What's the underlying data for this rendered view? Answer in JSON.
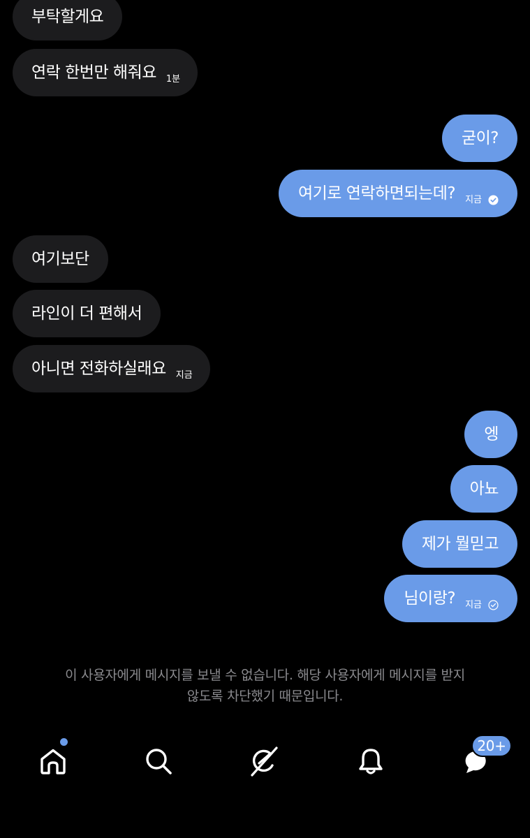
{
  "conversation": {
    "messages": [
      {
        "direction": "received",
        "text": "부탁할게요",
        "time": "",
        "read": false
      },
      {
        "direction": "received",
        "text": "연락 한번만 해줘요",
        "time": "1분",
        "read": false
      },
      {
        "direction": "sent",
        "text": "굳이?",
        "time": "",
        "read": false
      },
      {
        "direction": "sent",
        "text": "여기로 연락하면되는데?",
        "time": "지금",
        "read": true
      },
      {
        "direction": "received",
        "text": "여기보단",
        "time": "",
        "read": false
      },
      {
        "direction": "received",
        "text": "라인이 더 편해서",
        "time": "",
        "read": false
      },
      {
        "direction": "received",
        "text": "아니면 전화하실래요",
        "time": "지금",
        "read": false
      },
      {
        "direction": "sent",
        "text": "엥",
        "time": "",
        "read": false
      },
      {
        "direction": "sent",
        "text": "아뇨",
        "time": "",
        "read": false
      },
      {
        "direction": "sent",
        "text": "제가 뭘믿고",
        "time": "",
        "read": false
      },
      {
        "direction": "sent",
        "text": "님이랑?",
        "time": "지금",
        "read": false
      }
    ]
  },
  "blocked_notice": {
    "line1": "이 사용자에게 메시지를 보낼 수 없습니다. 해당 사용자에게 메시지를 받지",
    "line2": "않도록 차단했기 때문입니다."
  },
  "tabbar": {
    "items": [
      {
        "name": "home",
        "icon": "home-icon",
        "has_dot": true
      },
      {
        "name": "search",
        "icon": "search-icon",
        "has_dot": false
      },
      {
        "name": "grok",
        "icon": "grok-icon",
        "has_dot": false
      },
      {
        "name": "notifications",
        "icon": "bell-icon",
        "has_dot": false
      },
      {
        "name": "messages",
        "icon": "chat-bubbles-icon",
        "badge": "20+"
      }
    ]
  },
  "colors": {
    "background": "#000000",
    "received_bubble": "#1c1c1e",
    "sent_bubble": "#6a9be8",
    "accent": "#6a9be8",
    "muted_text": "#8a8a8e"
  }
}
